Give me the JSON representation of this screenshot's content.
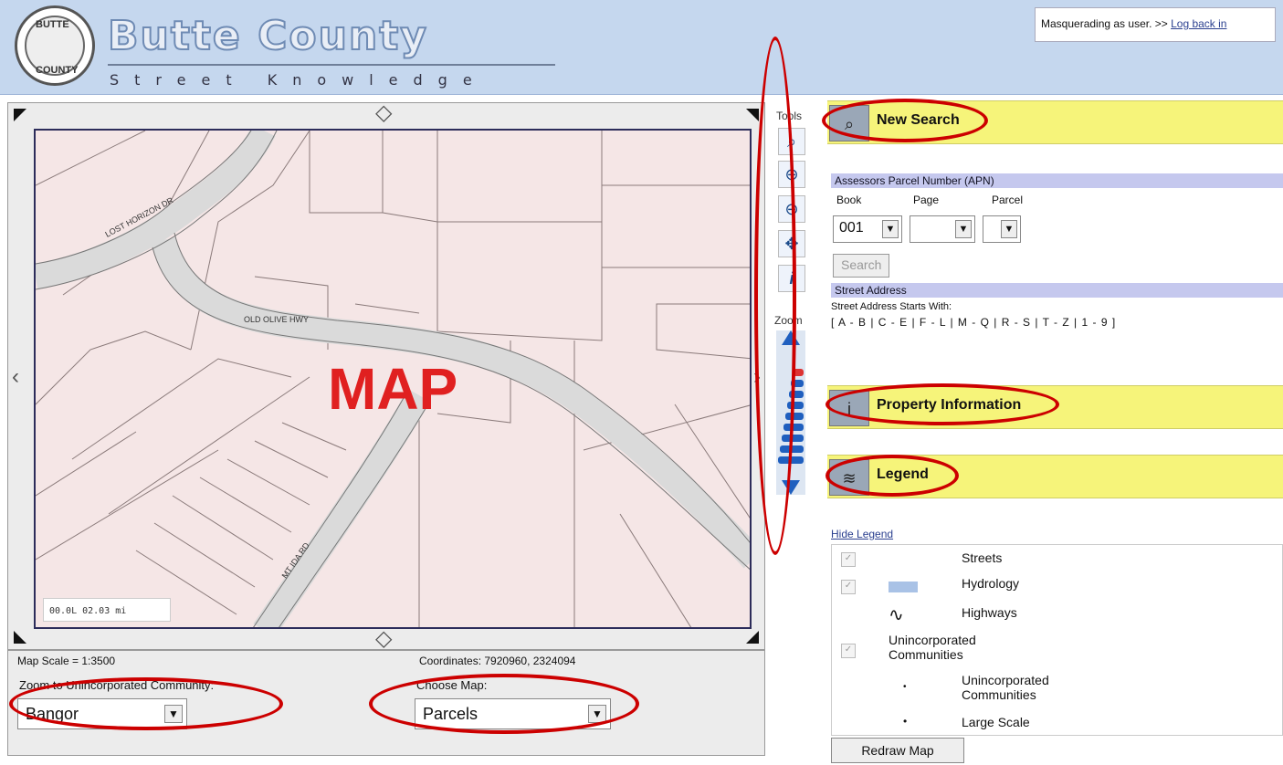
{
  "header": {
    "seal_top": "BUTTE",
    "seal_bottom": "COUNTY",
    "title": "Butte County",
    "subtitle": "Street Knowledge",
    "masquerade_text": "Masquerading as user. >> ",
    "login_link": "Log back in"
  },
  "map": {
    "overlay_label": "MAP",
    "streets": [
      "LOST HORIZON DR",
      "OLD OLIVE HWY",
      "MT IDA RD"
    ],
    "scalebar": "00.0L 02.03 mi",
    "scale_text": "Map Scale = 1:3500",
    "coordinates_text": "Coordinates: 7920960, 2324094"
  },
  "tools": {
    "label": "Tools",
    "zoom_label": "Zoom",
    "items": [
      "zoom-extent",
      "zoom-in",
      "zoom-out",
      "pan",
      "identify"
    ]
  },
  "controls": {
    "community_label": "Zoom to Unincorporated Community:",
    "community_value": "Bangor",
    "map_label": "Choose Map:",
    "map_value": "Parcels"
  },
  "search": {
    "title": "New Search",
    "apn_heading": "Assessors Parcel Number (APN)",
    "book_label": "Book",
    "page_label": "Page",
    "parcel_label": "Parcel",
    "book_value": "001",
    "page_value": "",
    "parcel_value": "",
    "search_button": "Search",
    "street_heading": "Street Address",
    "street_starts": "Street Address Starts With:",
    "alpha_links": "[ A - B | C - E | F - L | M - Q | R - S | T - Z | 1 - 9 ]"
  },
  "property": {
    "title": "Property Information"
  },
  "legend": {
    "title": "Legend",
    "hide_link": "Hide Legend",
    "items": [
      {
        "name": "Streets"
      },
      {
        "name": "Hydrology"
      },
      {
        "name": "Highways"
      },
      {
        "name": "Unincorporated Communities"
      },
      {
        "name": "Unincorporated Communities"
      },
      {
        "name": "Large Scale"
      }
    ],
    "redraw": "Redraw Map"
  },
  "colors": {
    "accent": "#f6f47a",
    "highlight": "#cc0000",
    "header_bg": "#c5d7ee"
  }
}
